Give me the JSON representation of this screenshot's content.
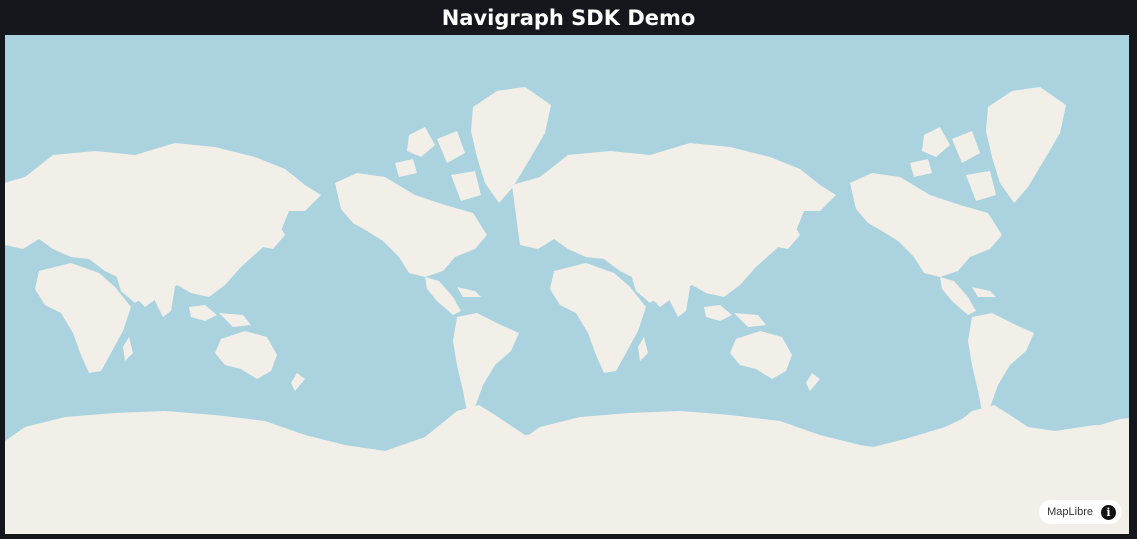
{
  "header": {
    "title": "Navigraph SDK Demo"
  },
  "map": {
    "attribution": "MapLibre",
    "info_icon": "info-icon",
    "colors": {
      "water": "#aad3df",
      "land": "#f2efe9",
      "page_background": "#16171d"
    }
  }
}
